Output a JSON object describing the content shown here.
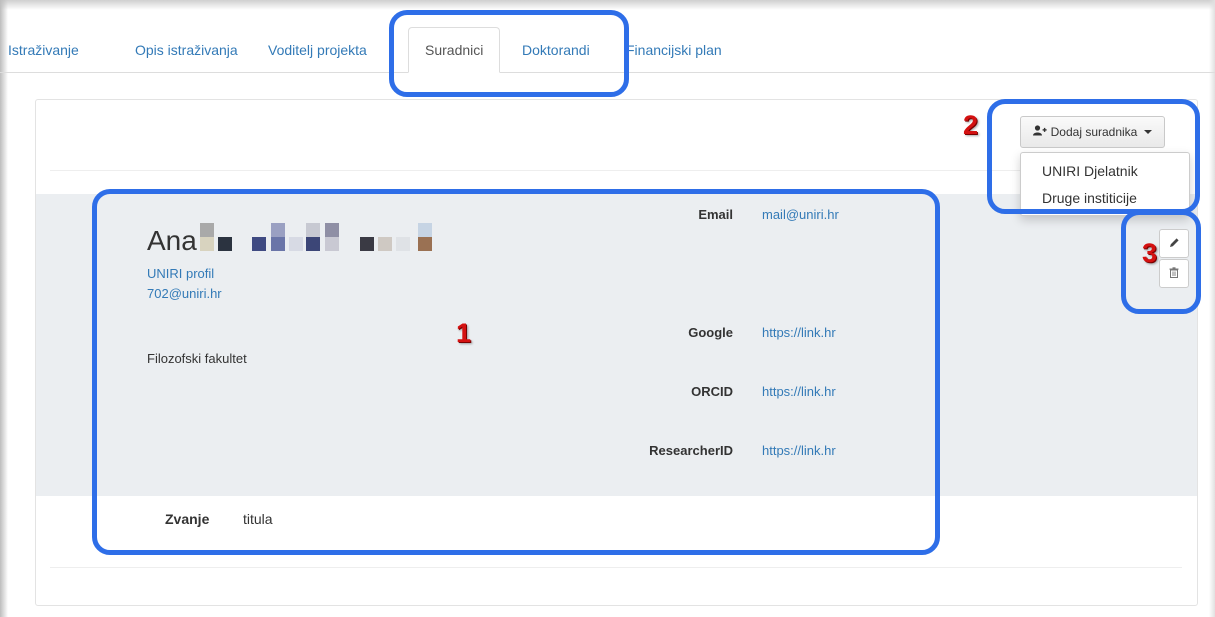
{
  "tabs": [
    {
      "label": "Istraživanje"
    },
    {
      "label": "Opis istraživanja"
    },
    {
      "label": "Voditelj projekta"
    },
    {
      "label": "Suradnici",
      "active": true
    },
    {
      "label": "Doktorandi"
    },
    {
      "label": "Financijski plan"
    }
  ],
  "add_button": {
    "label": "Dodaj suradnika",
    "icon": "user-plus-icon"
  },
  "dropdown_items": [
    "UNIRI Djelatnik",
    "Druge institicije"
  ],
  "person": {
    "first_name": "Ana",
    "profile_link": "UNIRI profil",
    "email_short": "702@uniri.hr",
    "institution": "Filozofski fakultet"
  },
  "contacts": [
    {
      "label": "Email",
      "value": "mail@uniri.hr"
    },
    {
      "label": "Google",
      "value": "https://link.hr"
    },
    {
      "label": "ORCID",
      "value": "https://link.hr"
    },
    {
      "label": "ResearcherID",
      "value": "https://link.hr"
    }
  ],
  "title_row": {
    "label": "Zvanje",
    "value": "titula"
  },
  "callouts": [
    "1",
    "2",
    "3"
  ],
  "colors": {
    "link": "#337ab7",
    "highlight": "#2e6ee8",
    "callout_number": "#d41111",
    "row_background": "#ebeef1"
  }
}
